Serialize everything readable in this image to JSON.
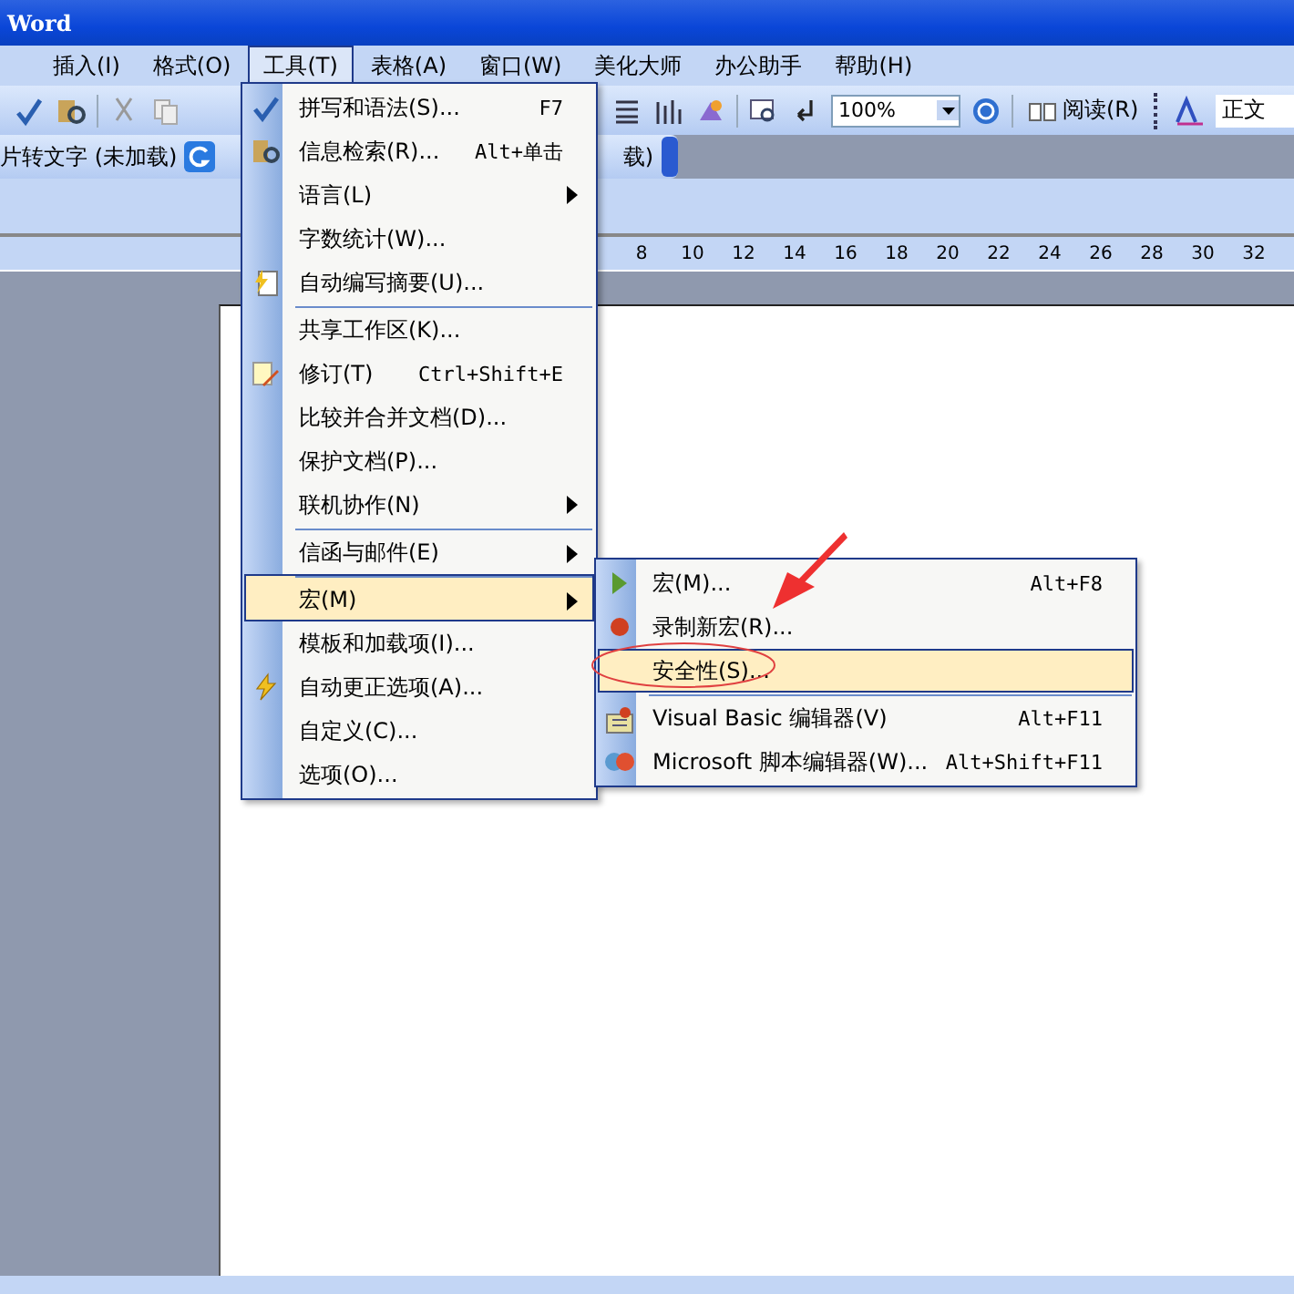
{
  "window": {
    "title": "Word"
  },
  "menu_bar": [
    {
      "label": "插入(I)",
      "selected": false
    },
    {
      "label": "格式(O)",
      "selected": false
    },
    {
      "label": "工具(T)",
      "selected": true
    },
    {
      "label": "表格(A)",
      "selected": false
    },
    {
      "label": "窗口(W)",
      "selected": false
    },
    {
      "label": "美化大师",
      "selected": false
    },
    {
      "label": "办公助手",
      "selected": false
    },
    {
      "label": "帮助(H)",
      "selected": false
    }
  ],
  "toolbar": {
    "zoom": "100%",
    "read_button": "阅读(R)",
    "style": "正文"
  },
  "toolbar2": {
    "left_text": "片转文字 (未加载)",
    "right_text": "载)"
  },
  "ruler": [
    "8",
    "10",
    "12",
    "14",
    "16",
    "18",
    "20",
    "22",
    "24",
    "26",
    "28",
    "30",
    "32"
  ],
  "tools_menu": [
    {
      "label": "拼写和语法(S)...",
      "shortcut": "F7",
      "kind": "spelling",
      "submenu": false,
      "separator_before": false,
      "selected": false
    },
    {
      "label": "信息检索(R)...",
      "shortcut": "Alt+单击",
      "kind": "research",
      "submenu": false,
      "separator_before": false,
      "selected": false
    },
    {
      "label": "语言(L)",
      "kind": "plain",
      "submenu": true,
      "separator_before": false,
      "selected": false
    },
    {
      "label": "字数统计(W)...",
      "kind": "plain",
      "submenu": false,
      "separator_before": false,
      "selected": false
    },
    {
      "label": "自动编写摘要(U)...",
      "kind": "summary",
      "submenu": false,
      "separator_before": false,
      "selected": false
    },
    {
      "label": "共享工作区(K)...",
      "kind": "plain",
      "submenu": false,
      "separator_before": true,
      "selected": false
    },
    {
      "label": "修订(T)",
      "shortcut": "Ctrl+Shift+E",
      "kind": "track",
      "submenu": false,
      "separator_before": false,
      "selected": false
    },
    {
      "label": "比较并合并文档(D)...",
      "kind": "plain",
      "submenu": false,
      "separator_before": false,
      "selected": false
    },
    {
      "label": "保护文档(P)...",
      "kind": "plain",
      "submenu": false,
      "separator_before": false,
      "selected": false
    },
    {
      "label": "联机协作(N)",
      "kind": "plain",
      "submenu": true,
      "separator_before": false,
      "selected": false
    },
    {
      "label": "信函与邮件(E)",
      "kind": "plain",
      "submenu": true,
      "separator_before": true,
      "selected": false
    },
    {
      "label": "宏(M)",
      "kind": "plain",
      "submenu": true,
      "separator_before": true,
      "selected": true
    },
    {
      "label": "模板和加载项(I)...",
      "kind": "plain",
      "submenu": false,
      "separator_before": false,
      "selected": false
    },
    {
      "label": "自动更正选项(A)...",
      "kind": "autocorrect",
      "submenu": false,
      "separator_before": false,
      "selected": false
    },
    {
      "label": "自定义(C)...",
      "kind": "plain",
      "submenu": false,
      "separator_before": false,
      "selected": false
    },
    {
      "label": "选项(O)...",
      "kind": "plain",
      "submenu": false,
      "separator_before": false,
      "selected": false
    }
  ],
  "macro_menu": [
    {
      "label": "宏(M)...",
      "shortcut": "Alt+F8",
      "kind": "play",
      "separator_before": false,
      "selected": false
    },
    {
      "label": "录制新宏(R)...",
      "kind": "record",
      "separator_before": false,
      "selected": false
    },
    {
      "label": "安全性(S)...",
      "kind": "plain",
      "separator_before": false,
      "selected": true
    },
    {
      "label": "Visual Basic 编辑器(V)",
      "shortcut": "Alt+F11",
      "kind": "vb",
      "separator_before": true,
      "selected": false
    },
    {
      "label": "Microsoft 脚本编辑器(W)...",
      "shortcut": "Alt+Shift+F11",
      "kind": "script",
      "separator_before": false,
      "selected": false
    }
  ]
}
